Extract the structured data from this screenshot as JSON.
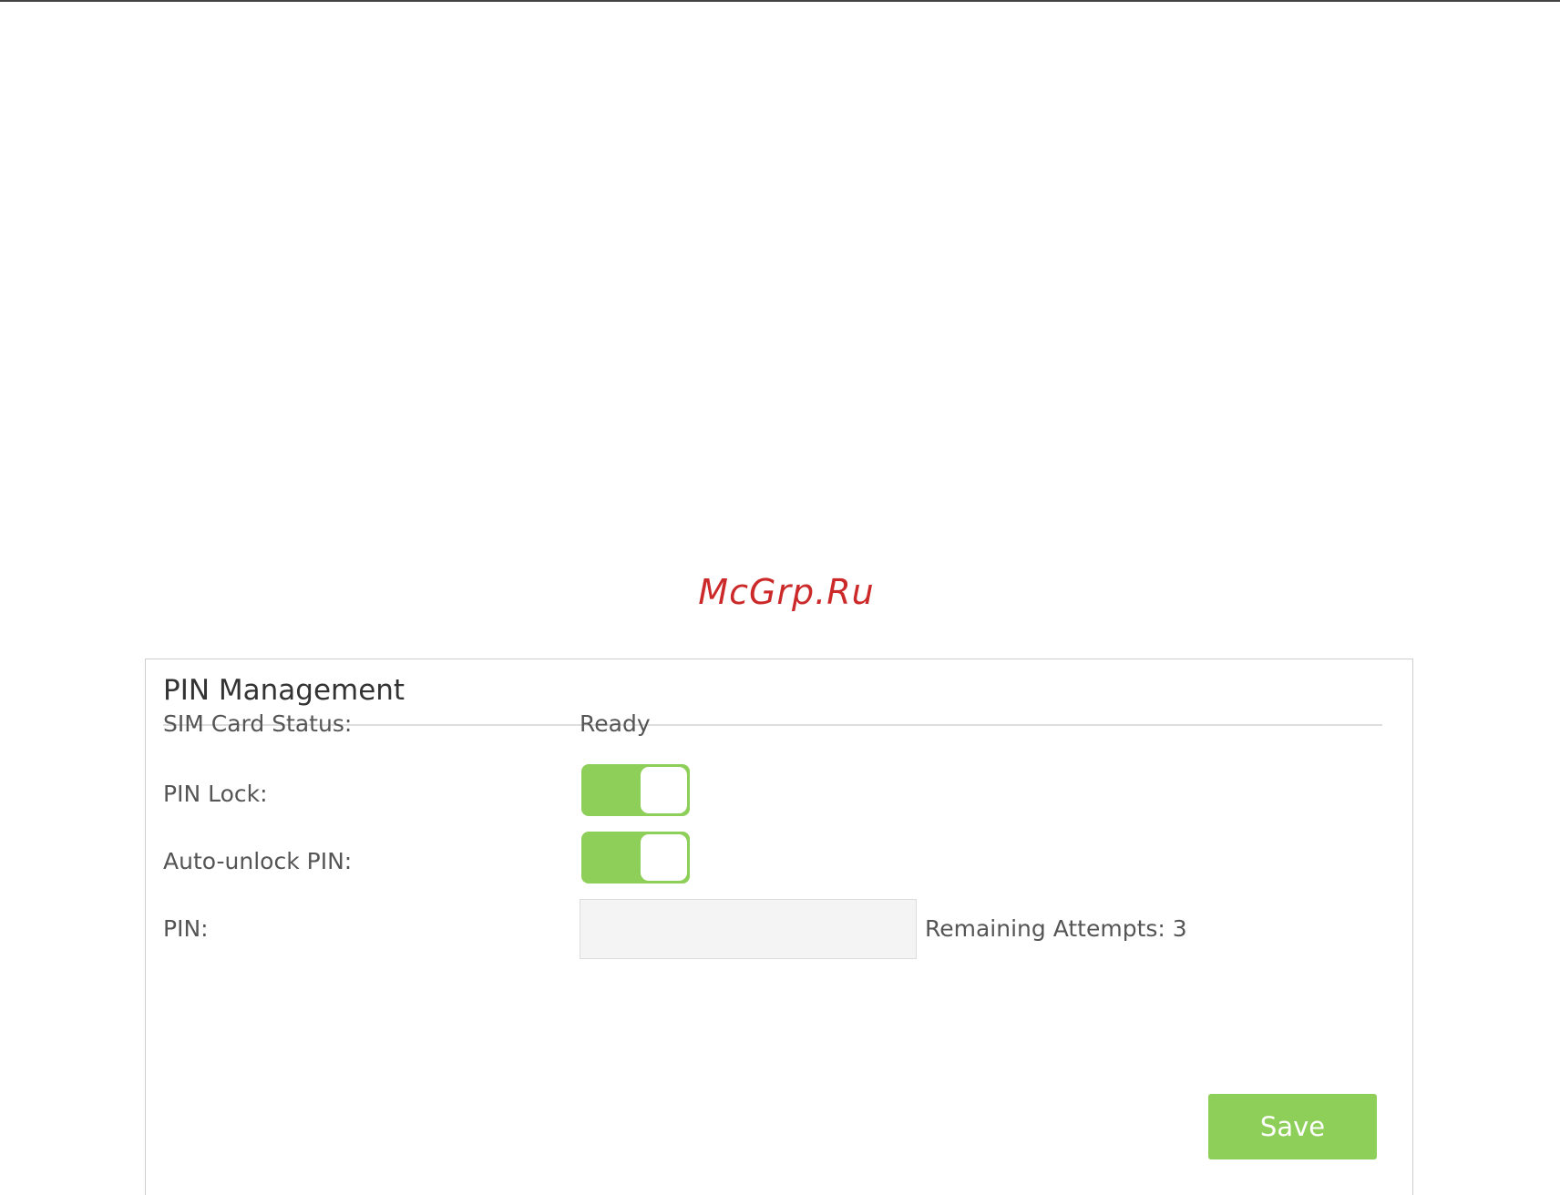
{
  "watermark": "McGrp.Ru",
  "panel": {
    "title": "PIN Management",
    "sim_status_label": "SIM Card Status:",
    "sim_status_value": "Ready",
    "pin_lock_label": "PIN Lock:",
    "pin_lock_on": true,
    "auto_unlock_label": "Auto-unlock PIN:",
    "auto_unlock_on": true,
    "pin_label": "PIN:",
    "pin_value": "",
    "remaining_attempts": "Remaining Attempts: 3",
    "save_label": "Save"
  },
  "colors": {
    "accent_green": "#8ecf5a",
    "watermark_red": "#cc2a2a"
  }
}
